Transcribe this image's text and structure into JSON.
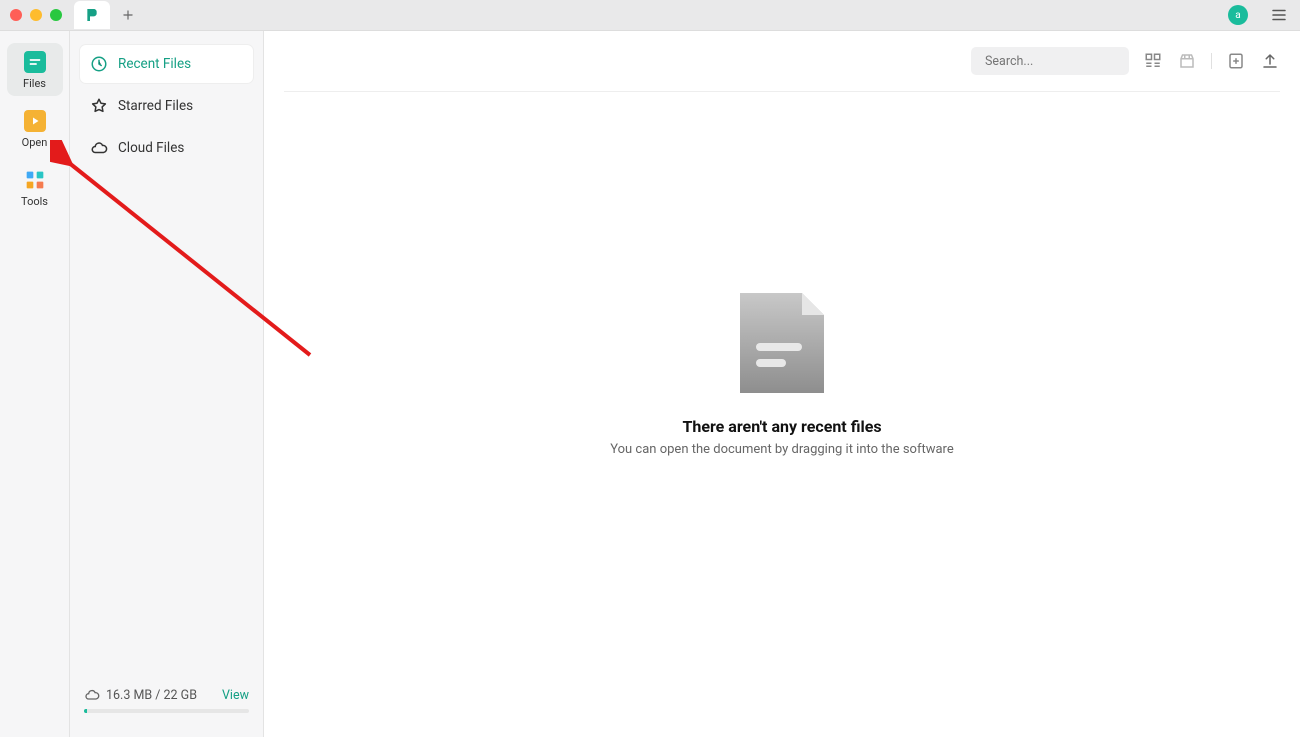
{
  "titlebar": {
    "avatar_letter": "a"
  },
  "rail": {
    "items": [
      {
        "label": "Files"
      },
      {
        "label": "Open"
      },
      {
        "label": "Tools"
      }
    ]
  },
  "side_nav": {
    "items": [
      {
        "label": "Recent Files"
      },
      {
        "label": "Starred Files"
      },
      {
        "label": "Cloud Files"
      }
    ]
  },
  "storage": {
    "text": "16.3 MB / 22 GB",
    "view_label": "View"
  },
  "toolbar": {
    "search_placeholder": "Search..."
  },
  "empty": {
    "title": "There aren't any recent files",
    "subtitle": "You can open the document by dragging it into the software"
  }
}
